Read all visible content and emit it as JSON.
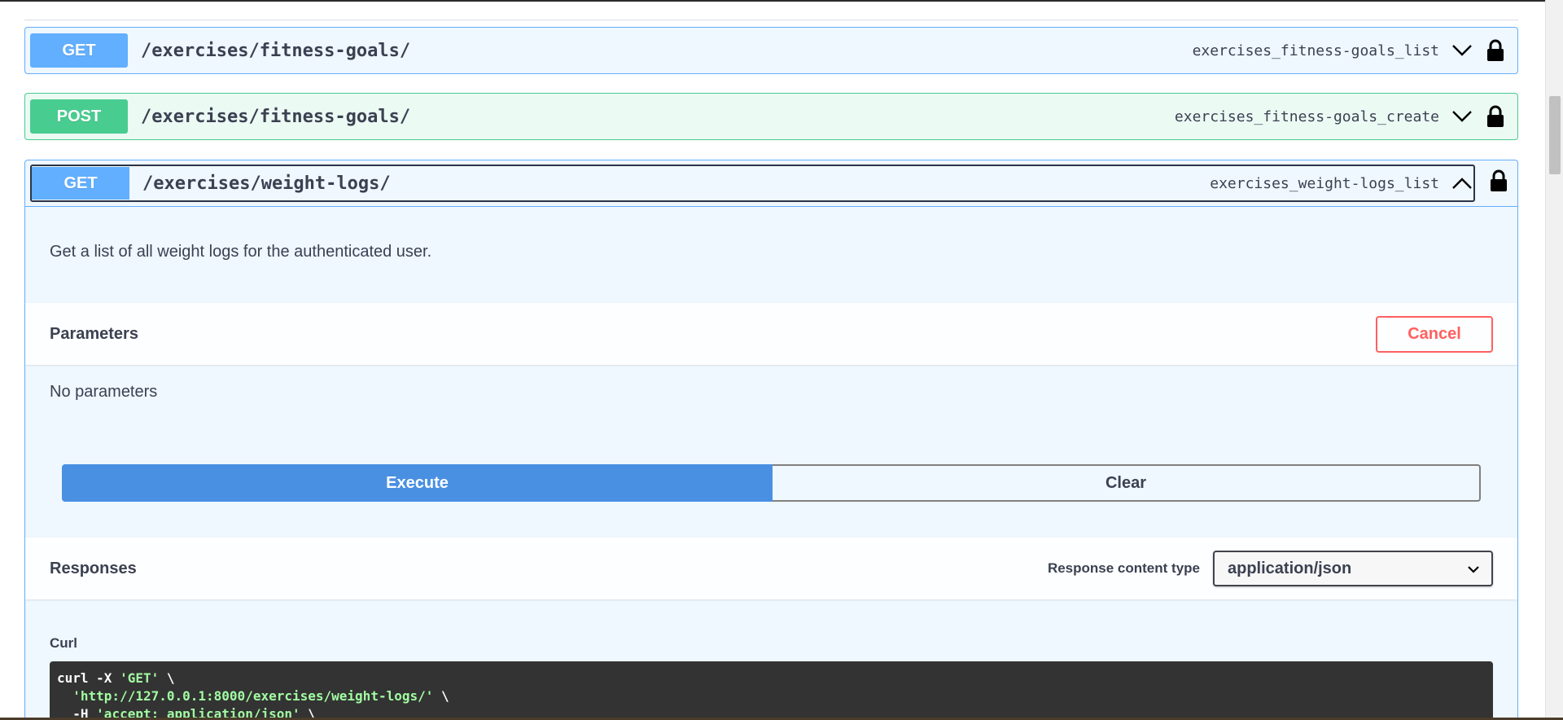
{
  "operations": [
    {
      "method": "GET",
      "path": "/exercises/fitness-goals/",
      "operation_id": "exercises_fitness-goals_list",
      "expanded": false
    },
    {
      "method": "POST",
      "path": "/exercises/fitness-goals/",
      "operation_id": "exercises_fitness-goals_create",
      "expanded": false
    },
    {
      "method": "GET",
      "path": "/exercises/weight-logs/",
      "operation_id": "exercises_weight-logs_list",
      "expanded": true,
      "description": "Get a list of all weight logs for the authenticated user.",
      "parameters_title": "Parameters",
      "cancel_label": "Cancel",
      "no_parameters": "No parameters",
      "execute_label": "Execute",
      "clear_label": "Clear",
      "responses_title": "Responses",
      "response_content_type_label": "Response content type",
      "response_content_type_value": "application/json",
      "curl_title": "Curl",
      "curl_lines": [
        {
          "plain": "curl -X ",
          "str": "'GET'",
          "after": " \\"
        },
        {
          "plain": "  ",
          "str": "'http://127.0.0.1:8000/exercises/weight-logs/'",
          "after": " \\"
        },
        {
          "plain": "  -H ",
          "str": "'accept: application/json'",
          "after": " \\"
        }
      ]
    }
  ],
  "icons": {
    "lock": "lock-icon",
    "chevron_down": "chevron-down-icon",
    "chevron_up": "chevron-up-icon",
    "select_arrow": "chevron-down-icon"
  },
  "colors": {
    "get": "#61affe",
    "post": "#49cc90",
    "execute": "#4990e2",
    "cancel": "#ff6060"
  }
}
